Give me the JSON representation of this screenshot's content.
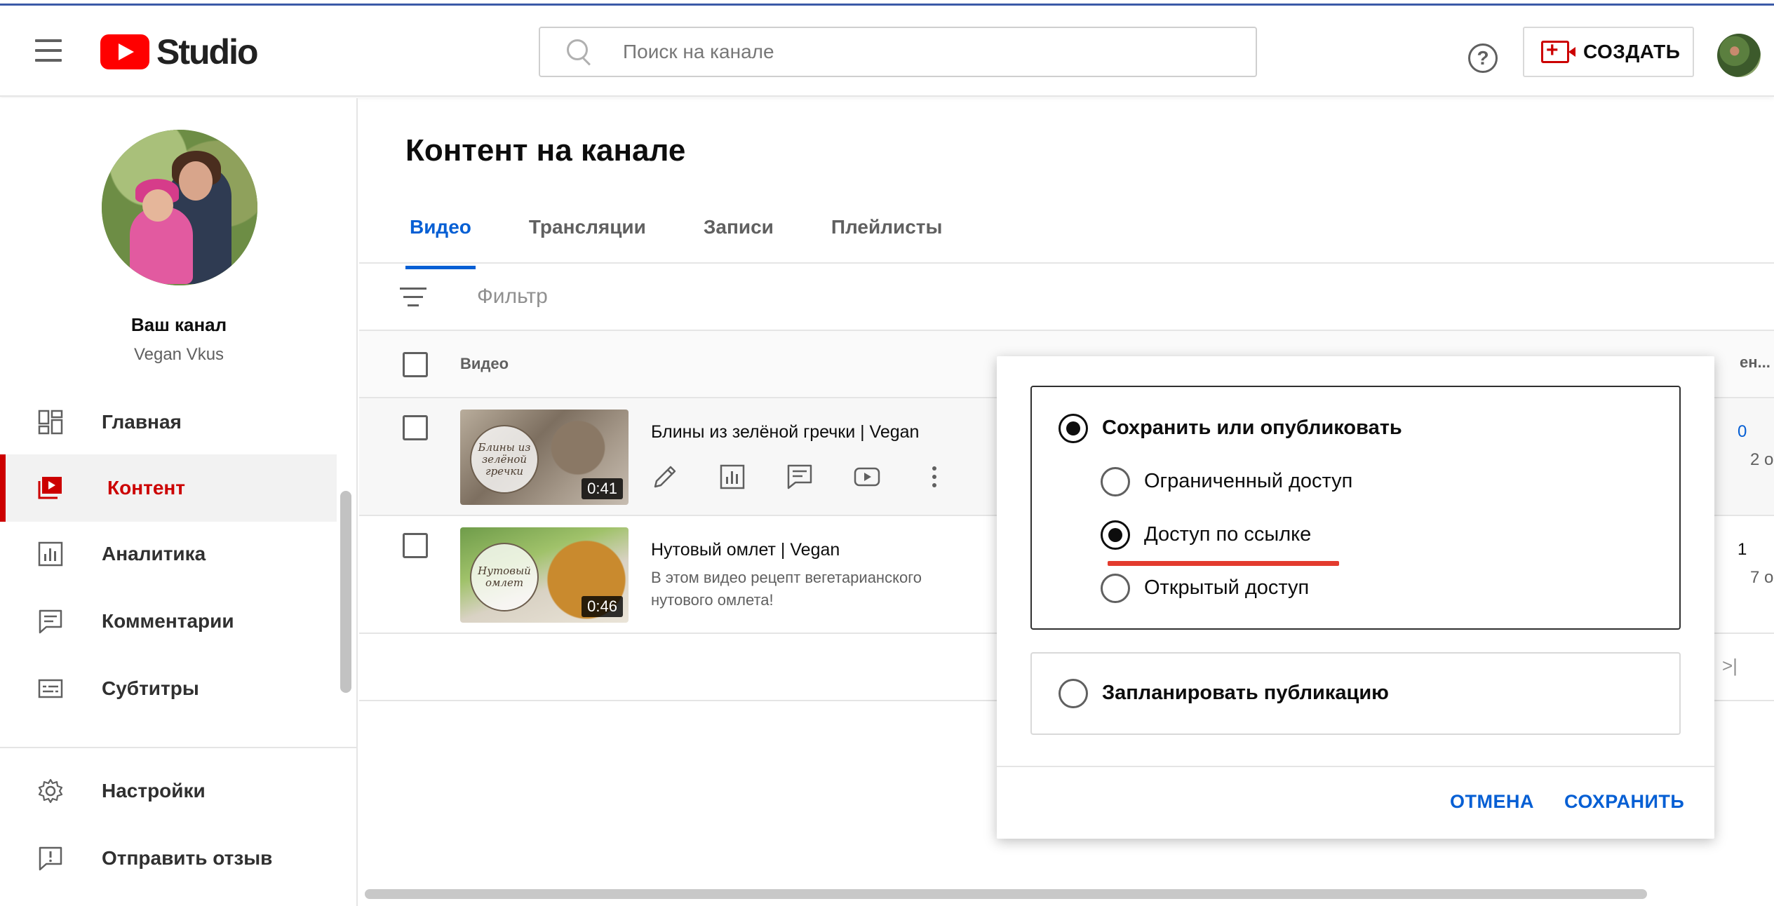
{
  "header": {
    "logo_text": "Studio",
    "search_placeholder": "Поиск на канале",
    "help_label": "?",
    "create_label": "СОЗДАТЬ"
  },
  "sidebar": {
    "channel_title": "Ваш канал",
    "channel_name": "Vegan Vkus",
    "items": [
      {
        "label": "Главная",
        "icon": "dashboard-icon"
      },
      {
        "label": "Контент",
        "icon": "content-icon",
        "active": true
      },
      {
        "label": "Аналитика",
        "icon": "analytics-icon"
      },
      {
        "label": "Комментарии",
        "icon": "comments-icon"
      },
      {
        "label": "Субтитры",
        "icon": "subtitles-icon"
      }
    ],
    "bottom_items": [
      {
        "label": "Настройки",
        "icon": "gear-icon"
      },
      {
        "label": "Отправить отзыв",
        "icon": "feedback-icon"
      }
    ]
  },
  "main": {
    "title": "Контент на канале",
    "tabs": [
      {
        "label": "Видео",
        "active": true
      },
      {
        "label": "Трансляции"
      },
      {
        "label": "Записи"
      },
      {
        "label": "Плейлисты"
      }
    ],
    "filter_label": "Фильтр",
    "table": {
      "col_video": "Видео",
      "col_right": "ен..."
    },
    "videos": [
      {
        "title": "Блины из зелёной гречки | Vegan",
        "description": "",
        "duration": "0:41",
        "thumb_text": "Блины из зелёной гречки",
        "right_value": "0",
        "right_sub": "2 о"
      },
      {
        "title": "Нутовый омлет | Vegan",
        "description": "В этом видео рецепт вегетарианского нутового омлета!",
        "duration": "0:46",
        "thumb_text": "Нутовый омлет",
        "right_value": "1",
        "right_sub": "7 о"
      }
    ],
    "pager_arrow": ">|"
  },
  "popup": {
    "option_save": "Сохранить или опубликовать",
    "option_private": "Ограниченный доступ",
    "option_unlisted": "Доступ по ссылке",
    "option_public": "Открытый доступ",
    "option_schedule": "Запланировать публикацию",
    "selected": "unlisted",
    "cancel_label": "ОТМЕНА",
    "save_label": "СОХРАНИТЬ"
  },
  "colors": {
    "accent_red": "#cc0000",
    "link_blue": "#065fd4",
    "highlight_underline": "#e33b2e"
  }
}
